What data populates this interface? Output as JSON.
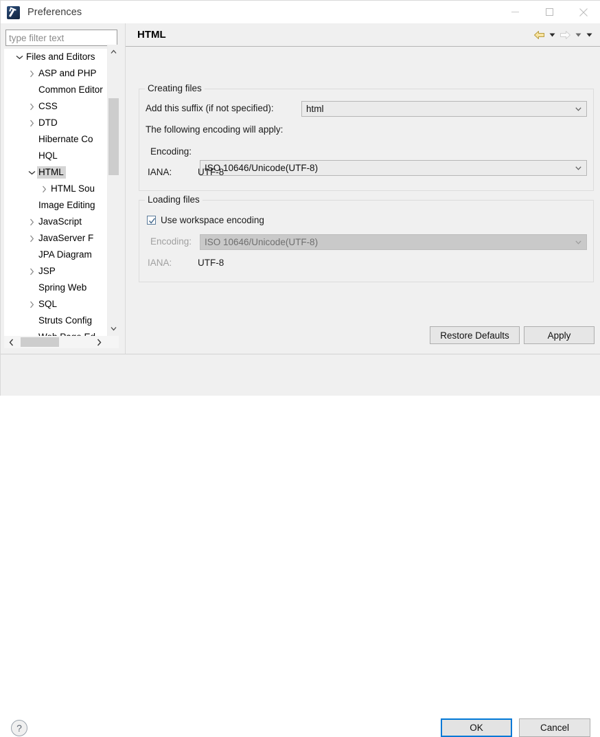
{
  "window": {
    "title": "Preferences",
    "icon": "eclipse-preferences-icon",
    "minimize_label": "Minimize",
    "maximize_label": "Maximize",
    "close_label": "Close"
  },
  "filter": {
    "placeholder": "type filter text",
    "value": ""
  },
  "tree": {
    "items": [
      {
        "label": "Files and Editors",
        "indent": 0,
        "twisty": "expanded",
        "selected": false
      },
      {
        "label": "ASP and PHP",
        "indent": 1,
        "twisty": "collapsed",
        "selected": false
      },
      {
        "label": "Common Editor",
        "indent": 1,
        "twisty": "none",
        "selected": false
      },
      {
        "label": "CSS",
        "indent": 1,
        "twisty": "collapsed",
        "selected": false
      },
      {
        "label": "DTD",
        "indent": 1,
        "twisty": "collapsed",
        "selected": false
      },
      {
        "label": "Hibernate Co",
        "indent": 1,
        "twisty": "none",
        "selected": false
      },
      {
        "label": "HQL",
        "indent": 1,
        "twisty": "none",
        "selected": false
      },
      {
        "label": "HTML",
        "indent": 1,
        "twisty": "expanded",
        "selected": true
      },
      {
        "label": "HTML Sou",
        "indent": 2,
        "twisty": "collapsed",
        "selected": false
      },
      {
        "label": "Image Editing",
        "indent": 1,
        "twisty": "none",
        "selected": false
      },
      {
        "label": "JavaScript",
        "indent": 1,
        "twisty": "collapsed",
        "selected": false
      },
      {
        "label": "JavaServer F",
        "indent": 1,
        "twisty": "collapsed",
        "selected": false
      },
      {
        "label": "JPA Diagram",
        "indent": 1,
        "twisty": "none",
        "selected": false
      },
      {
        "label": "JSP",
        "indent": 1,
        "twisty": "collapsed",
        "selected": false
      },
      {
        "label": "Spring Web",
        "indent": 1,
        "twisty": "none",
        "selected": false
      },
      {
        "label": "SQL",
        "indent": 1,
        "twisty": "collapsed",
        "selected": false
      },
      {
        "label": "Struts Config",
        "indent": 1,
        "twisty": "none",
        "selected": false
      },
      {
        "label": "Web Page Ed",
        "indent": 1,
        "twisty": "none",
        "selected": false
      }
    ]
  },
  "page": {
    "title": "HTML",
    "nav": {
      "back_label": "Back",
      "back_state": "enabled",
      "forward_label": "Forward",
      "forward_state": "disabled",
      "back_menu_label": "Back history",
      "forward_menu_label": "Forward history",
      "view_menu_label": "View menu"
    }
  },
  "creating_files": {
    "group_label": "Creating files",
    "suffix_label": "Add this suffix (if not specified):",
    "suffix_value": "html",
    "encoding_note": "The following encoding will apply:",
    "encoding_label": "Encoding:",
    "encoding_value": "ISO 10646/Unicode(UTF-8)",
    "iana_label": "IANA:",
    "iana_value": "UTF-8"
  },
  "loading_files": {
    "group_label": "Loading files",
    "use_workspace_label": "Use workspace encoding",
    "use_workspace_checked": true,
    "encoding_label": "Encoding:",
    "encoding_value": "ISO 10646/Unicode(UTF-8)",
    "encoding_disabled": true,
    "iana_label": "IANA:",
    "iana_value": "UTF-8"
  },
  "buttons": {
    "restore_defaults": "Restore Defaults",
    "apply": "Apply",
    "ok": "OK",
    "cancel": "Cancel",
    "help": "?"
  },
  "colors": {
    "dialog_bg": "#f0f0f0",
    "focus_blue": "#0078d7",
    "nav_back_gold": "#f5d97a",
    "selection_grey": "#d5d5d5",
    "disabled_combo": "#c9c9c9"
  }
}
